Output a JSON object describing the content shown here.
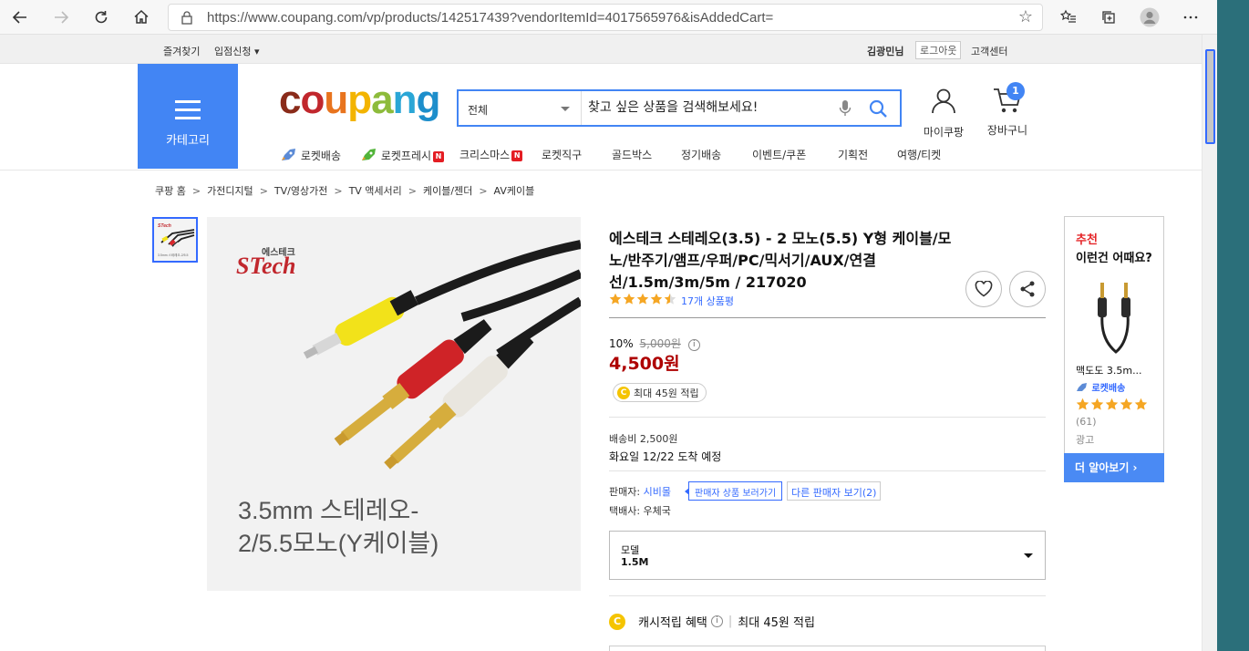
{
  "browser": {
    "url": "https://www.coupang.com/vp/products/142517439?vendorItemId=4017565976&isAddedCart="
  },
  "util_bar": {
    "favorites": "즐겨찾기",
    "partner": "입점신청 ▾",
    "user": "김광민님",
    "logout": "로그아웃",
    "customer_center": "고객센터"
  },
  "header": {
    "category_label": "카테고리",
    "logo_letters": [
      "c",
      "o",
      "u",
      "p",
      "a",
      "n",
      "g"
    ],
    "search_category": "전체",
    "search_placeholder": "찾고 싶은 상품을 검색해보세요!",
    "mypage_label": "마이쿠팡",
    "cart_label": "장바구니",
    "cart_count": "1",
    "nav": [
      {
        "label": "로켓배송",
        "icon": "rocket-icon"
      },
      {
        "label": "로켓프레시",
        "icon": "rocket-fresh-icon",
        "badge": "N"
      },
      {
        "label": "크리스마스",
        "badge": "N"
      },
      {
        "label": "로켓직구"
      },
      {
        "label": "골드박스"
      },
      {
        "label": "정기배송"
      },
      {
        "label": "이벤트/쿠폰"
      },
      {
        "label": "기획전"
      },
      {
        "label": "여행/티켓"
      }
    ]
  },
  "breadcrumb": [
    "쿠팡 홈",
    "가전디지털",
    "TV/영상가전",
    "TV 액세서리",
    "케이블/젠더",
    "AV케이블"
  ],
  "product": {
    "image_brand": "에스테크",
    "image_logo": "STech",
    "image_caption_1": "3.5mm 스테레오-",
    "image_caption_2": "2/5.5모노(Y케이블)",
    "title": "에스테크 스테레오(3.5) - 2 모노(5.5) Y형 케이블/모노/반주기/앰프/우퍼/PC/믹서기/AUX/연결 선/1.5m/3m/5m / 217020",
    "rating": 4.5,
    "review_count": "17개 상품평",
    "discount_rate": "10%",
    "original_price": "5,000원",
    "price": "4,500원",
    "cash_back": "최대 45원 적립",
    "shipping_fee": "배송비 2,500원",
    "delivery_date": "화요일 12/22 도착 예정",
    "seller_label": "판매자:",
    "seller_name": "시비몰",
    "seller_tooltip": "판매자 상품 보러가기",
    "other_sellers": "다른 판매자 보기(2)",
    "courier": "택배사: 우체국",
    "option_label": "모델",
    "option_value": "1.5M",
    "cash_benefit_label": "캐시적립 혜택",
    "cash_benefit_value": "최대 45원 적립",
    "colors": {
      "price": "#ae0000",
      "link": "#346aff",
      "star": "#f5a623"
    }
  },
  "recommendation": {
    "heading_1": "추천",
    "heading_2": "이런건 어때요?",
    "item_name": "맥도도 3.5m...",
    "rocket_label": "로켓배송",
    "rating": 5,
    "review_count": "(61)",
    "ad_label": "광고",
    "more_button": "더 알아보기 ›"
  }
}
